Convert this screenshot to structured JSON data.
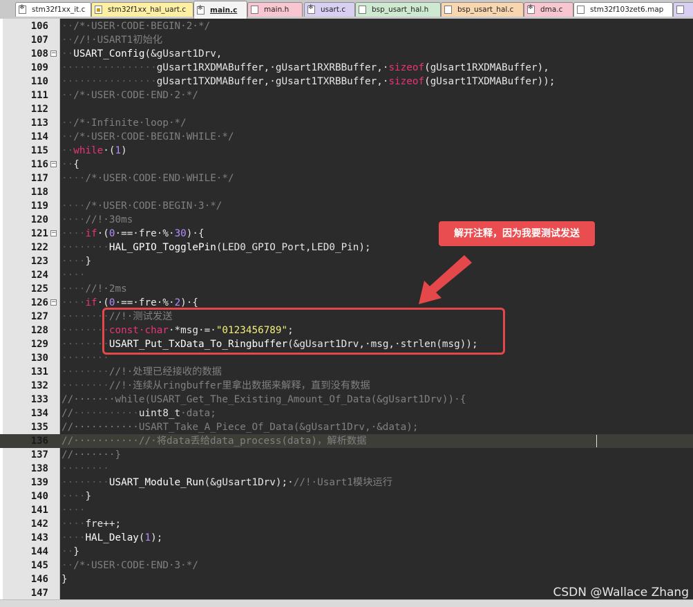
{
  "tabs": [
    {
      "label": "stm32f1xx_it.c",
      "color": "#ffffff",
      "icon": "gear-file-icon",
      "active": false
    },
    {
      "label": "stm32f1xx_hal_uart.c",
      "color": "#fdf0a5",
      "icon": "lock-file-icon",
      "active": false
    },
    {
      "label": "main.c",
      "color": "#f4f4f4",
      "icon": "gear-file-icon",
      "active": true
    },
    {
      "label": "main.h",
      "color": "#f7c6d0",
      "icon": "file-icon",
      "active": false
    },
    {
      "label": "usart.c",
      "color": "#d8cff3",
      "icon": "gear-file-icon",
      "active": false
    },
    {
      "label": "bsp_usart_hal.h",
      "color": "#cde9d0",
      "icon": "file-icon",
      "active": false
    },
    {
      "label": "bsp_usart_hal.c",
      "color": "#f8d7b0",
      "icon": "file-icon",
      "active": false
    },
    {
      "label": "dma.c",
      "color": "#f7c6d0",
      "icon": "gear-file-icon",
      "active": false
    },
    {
      "label": "stm32f103zet6.map",
      "color": "#ffffff",
      "icon": "file-icon",
      "active": false
    },
    {
      "label": "",
      "color": "#d8cff3",
      "icon": "file-icon",
      "active": false
    }
  ],
  "colors": {
    "accent": "#e5484a",
    "editor_bg": "#2b2b2b",
    "keyword": "#e8357a",
    "string": "#f3f07a",
    "number": "#b48cff",
    "comment": "#808080"
  },
  "current_line": 136,
  "lines": [
    {
      "n": "106",
      "fold": "",
      "tokens": [
        [
          "ws",
          "··"
        ],
        [
          "cm",
          "/*·USER·CODE·BEGIN·2·*/"
        ]
      ]
    },
    {
      "n": "107",
      "fold": "",
      "tokens": [
        [
          "ws",
          "··"
        ],
        [
          "cm",
          "//!·USART1初始化"
        ]
      ]
    },
    {
      "n": "108",
      "fold": "−",
      "tokens": [
        [
          "ws",
          "··"
        ],
        [
          "fn",
          "USART_Config"
        ],
        [
          "op",
          "("
        ],
        [
          "pl",
          "&gUsart1Drv,"
        ]
      ]
    },
    {
      "n": "109",
      "fold": "",
      "tokens": [
        [
          "ws",
          "················"
        ],
        [
          "pl",
          "gUsart1RXDMABuffer,·gUsart1RXRBBuffer,·"
        ],
        [
          "kw",
          "sizeof"
        ],
        [
          "op",
          "("
        ],
        [
          "pl",
          "gUsart1RXDMABuffer),"
        ]
      ]
    },
    {
      "n": "110",
      "fold": "",
      "tokens": [
        [
          "ws",
          "················"
        ],
        [
          "pl",
          "gUsart1TXDMABuffer,·gUsart1TXRBBuffer,·"
        ],
        [
          "kw",
          "sizeof"
        ],
        [
          "op",
          "("
        ],
        [
          "pl",
          "gUsart1TXDMABuffer));"
        ]
      ]
    },
    {
      "n": "111",
      "fold": "",
      "tokens": [
        [
          "ws",
          "··"
        ],
        [
          "cm",
          "/*·USER·CODE·END·2·*/"
        ]
      ]
    },
    {
      "n": "112",
      "fold": "",
      "tokens": []
    },
    {
      "n": "113",
      "fold": "",
      "tokens": [
        [
          "ws",
          "··"
        ],
        [
          "cm",
          "/*·Infinite·loop·*/"
        ]
      ]
    },
    {
      "n": "114",
      "fold": "",
      "tokens": [
        [
          "ws",
          "··"
        ],
        [
          "cm",
          "/*·USER·CODE·BEGIN·WHILE·*/"
        ]
      ]
    },
    {
      "n": "115",
      "fold": "",
      "tokens": [
        [
          "ws",
          "··"
        ],
        [
          "kw",
          "while"
        ],
        [
          "pl",
          "·("
        ],
        [
          "num",
          "1"
        ],
        [
          "pl",
          ")"
        ]
      ]
    },
    {
      "n": "116",
      "fold": "−",
      "tokens": [
        [
          "ws",
          "··"
        ],
        [
          "pl",
          "{"
        ]
      ]
    },
    {
      "n": "117",
      "fold": "",
      "tokens": [
        [
          "ws",
          "····"
        ],
        [
          "cm",
          "/*·USER·CODE·END·WHILE·*/"
        ]
      ]
    },
    {
      "n": "118",
      "fold": "",
      "tokens": []
    },
    {
      "n": "119",
      "fold": "",
      "tokens": [
        [
          "ws",
          "····"
        ],
        [
          "cm",
          "/*·USER·CODE·BEGIN·3·*/"
        ]
      ]
    },
    {
      "n": "120",
      "fold": "",
      "tokens": [
        [
          "ws",
          "····"
        ],
        [
          "cm",
          "//!·30ms"
        ]
      ]
    },
    {
      "n": "121",
      "fold": "−",
      "tokens": [
        [
          "ws",
          "····"
        ],
        [
          "kw",
          "if"
        ],
        [
          "pl",
          "·("
        ],
        [
          "num",
          "0"
        ],
        [
          "pl",
          "·==·fre·%·"
        ],
        [
          "num",
          "30"
        ],
        [
          "pl",
          ")·{"
        ]
      ]
    },
    {
      "n": "122",
      "fold": "",
      "tokens": [
        [
          "ws",
          "········"
        ],
        [
          "fn",
          "HAL_GPIO_TogglePin"
        ],
        [
          "pl",
          "(LED0_GPIO_Port,LED0_Pin);"
        ]
      ]
    },
    {
      "n": "123",
      "fold": "",
      "tokens": [
        [
          "ws",
          "····"
        ],
        [
          "pl",
          "}"
        ]
      ]
    },
    {
      "n": "124",
      "fold": "",
      "tokens": [
        [
          "ws",
          "····"
        ]
      ]
    },
    {
      "n": "125",
      "fold": "",
      "tokens": [
        [
          "ws",
          "····"
        ],
        [
          "cm",
          "//!·2ms"
        ]
      ]
    },
    {
      "n": "126",
      "fold": "−",
      "tokens": [
        [
          "ws",
          "····"
        ],
        [
          "kw",
          "if"
        ],
        [
          "pl",
          "·("
        ],
        [
          "num",
          "0"
        ],
        [
          "pl",
          "·==·fre·%·"
        ],
        [
          "num",
          "2"
        ],
        [
          "pl",
          ")·{"
        ]
      ]
    },
    {
      "n": "127",
      "fold": "",
      "tokens": [
        [
          "ws",
          "········"
        ],
        [
          "cm",
          "//!·测试发送"
        ]
      ]
    },
    {
      "n": "128",
      "fold": "",
      "tokens": [
        [
          "ws",
          "········"
        ],
        [
          "kw",
          "const·char"
        ],
        [
          "pl",
          "·*msg·=·"
        ],
        [
          "str",
          "\"0123456789\""
        ],
        [
          "pl",
          ";"
        ]
      ]
    },
    {
      "n": "129",
      "fold": "",
      "tokens": [
        [
          "ws",
          "········"
        ],
        [
          "fn",
          "USART_Put_TxData_To_Ringbuffer"
        ],
        [
          "pl",
          "(&gUsart1Drv,·msg,·strlen(msg));"
        ]
      ]
    },
    {
      "n": "130",
      "fold": "",
      "tokens": [
        [
          "ws",
          "········"
        ]
      ]
    },
    {
      "n": "131",
      "fold": "",
      "tokens": [
        [
          "ws",
          "········"
        ],
        [
          "cm",
          "//!·处理已经接收的数据"
        ]
      ]
    },
    {
      "n": "132",
      "fold": "",
      "tokens": [
        [
          "ws",
          "········"
        ],
        [
          "cm",
          "//!·连续从ringbuffer里拿出数据来解释，直到没有数据"
        ]
      ]
    },
    {
      "n": "133",
      "fold": "",
      "tokens": [
        [
          "cm",
          "//·······while(USART_Get_The_Existing_Amount_Of_Data(&gUsart1Drv))·{"
        ]
      ]
    },
    {
      "n": "134",
      "fold": "",
      "tokens": [
        [
          "cm",
          "//"
        ],
        [
          "ws",
          "···········"
        ],
        [
          "pl",
          "uint8_t"
        ],
        [
          "cm",
          "·data;"
        ]
      ]
    },
    {
      "n": "135",
      "fold": "",
      "tokens": [
        [
          "cm",
          "//···········USART_Take_A_Piece_Of_Data(&gUsart1Drv,·&data);"
        ]
      ]
    },
    {
      "n": "136",
      "fold": "",
      "tokens": [
        [
          "cm",
          "//···········//·将data丢给data_process(data)，解析数据"
        ]
      ]
    },
    {
      "n": "137",
      "fold": "",
      "tokens": [
        [
          "cm",
          "//·······}"
        ]
      ]
    },
    {
      "n": "138",
      "fold": "",
      "tokens": [
        [
          "ws",
          "········"
        ]
      ]
    },
    {
      "n": "139",
      "fold": "",
      "tokens": [
        [
          "ws",
          "········"
        ],
        [
          "fn",
          "USART_Module_Run"
        ],
        [
          "pl",
          "(&gUsart1Drv);·"
        ],
        [
          "cm",
          "//!·Usart1模块运行"
        ]
      ]
    },
    {
      "n": "140",
      "fold": "",
      "tokens": [
        [
          "ws",
          "····"
        ],
        [
          "pl",
          "}"
        ]
      ]
    },
    {
      "n": "141",
      "fold": "",
      "tokens": [
        [
          "ws",
          "····"
        ]
      ]
    },
    {
      "n": "142",
      "fold": "",
      "tokens": [
        [
          "ws",
          "····"
        ],
        [
          "pl",
          "fre++;"
        ]
      ]
    },
    {
      "n": "143",
      "fold": "",
      "tokens": [
        [
          "ws",
          "····"
        ],
        [
          "fn",
          "HAL_Delay"
        ],
        [
          "pl",
          "("
        ],
        [
          "num",
          "1"
        ],
        [
          "pl",
          ");"
        ]
      ]
    },
    {
      "n": "144",
      "fold": "",
      "tokens": [
        [
          "ws",
          "··"
        ],
        [
          "pl",
          "}"
        ]
      ]
    },
    {
      "n": "145",
      "fold": "",
      "tokens": [
        [
          "ws",
          "··"
        ],
        [
          "cm",
          "/*·USER·CODE·END·3·*/"
        ]
      ]
    },
    {
      "n": "146",
      "fold": "",
      "tokens": [
        [
          "pl",
          "}"
        ]
      ]
    },
    {
      "n": "147",
      "fold": "",
      "tokens": []
    }
  ],
  "annotation": {
    "callout_text": "解开注释，因为我要测试发送"
  },
  "watermark": "CSDN @Wallace Zhang"
}
